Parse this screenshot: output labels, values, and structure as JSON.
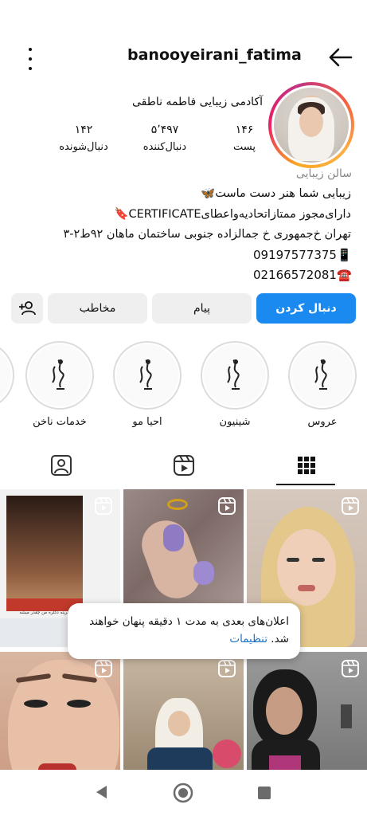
{
  "header": {
    "username": "banooyeirani_fatima"
  },
  "profile": {
    "display_name": "آکادمی زیبایی فاطمه ناطقی",
    "stats": [
      {
        "value": "۱۴۶",
        "label": "پست"
      },
      {
        "value": "۵٬۴۹۷",
        "label": "دنبال‌کننده"
      },
      {
        "value": "۱۴۲",
        "label": "دنبال‌شونده"
      }
    ],
    "category": "سالن زیبایی",
    "bio_lines": [
      "زیبایی شما هنر دست ماست🦋",
      "دارای‌مجوز ممتازاتحادیه‌واعطایCERTIFICATE🔖",
      "تهران خ‌جمهوری خ جمالزاده جنوبی ساختمان ماهان ۹۲ط۲-۳",
      "09197577375📱",
      "02166572081☎️"
    ]
  },
  "actions": {
    "follow": "دنبال کردن",
    "message": "پیام",
    "contact": "مخاطب"
  },
  "highlights": [
    {
      "label": "عروس"
    },
    {
      "label": "شینیون"
    },
    {
      "label": "احیا مو"
    },
    {
      "label": "خدمات ناخن"
    }
  ],
  "tabs": [
    "grid",
    "reels",
    "tagged"
  ],
  "posts": [
    {
      "caption": "هرینه دکلره من چقدر میشه"
    },
    {
      "caption": ""
    },
    {
      "caption": ""
    },
    {
      "caption": ""
    },
    {
      "caption": ""
    },
    {
      "caption": ""
    }
  ],
  "toast": {
    "text": "اعلان‌های بعدی به مدت ۱ دقیقه پنهان خواهند شد.",
    "link": "تنظیمات"
  },
  "colors": {
    "follow_button": "#1a8af0",
    "secondary_button": "#efefef",
    "link": "#1a73c8"
  }
}
